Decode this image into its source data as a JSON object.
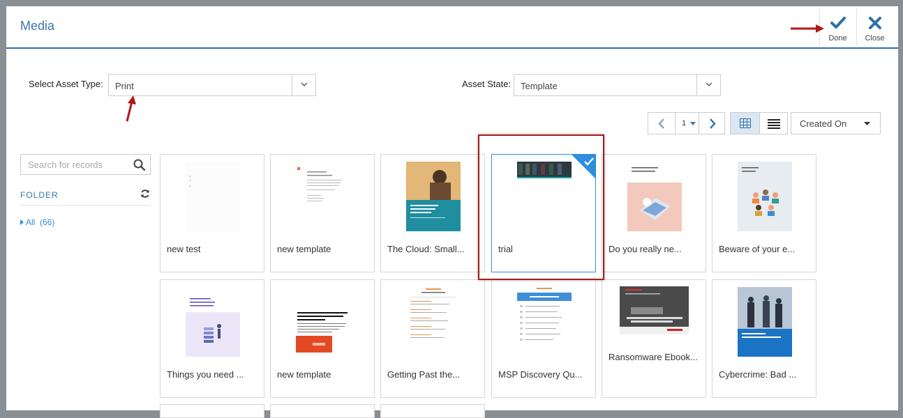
{
  "modal": {
    "title": "Media",
    "done_label": "Done",
    "close_label": "Close"
  },
  "filters": {
    "asset_type_label": "Select Asset Type:",
    "asset_type_value": "Print",
    "asset_state_label": "Asset State:",
    "asset_state_value": "Template"
  },
  "pager": {
    "current_page": "1"
  },
  "sort": {
    "value": "Created On"
  },
  "sidebar": {
    "search_placeholder": "Search for records",
    "folder_label": "FOLDER",
    "all_label": "All",
    "all_count": "(66)"
  },
  "assets": [
    {
      "name": "new test",
      "selected": false
    },
    {
      "name": "new template",
      "selected": false
    },
    {
      "name": "The Cloud: Small...",
      "selected": false
    },
    {
      "name": "trial",
      "selected": true
    },
    {
      "name": "Do you really ne...",
      "selected": false
    },
    {
      "name": "Beware of your e...",
      "selected": false
    },
    {
      "name": "Things you need ...",
      "selected": false
    },
    {
      "name": "new template",
      "selected": false
    },
    {
      "name": "Getting Past the...",
      "selected": false
    },
    {
      "name": "MSP Discovery Qu...",
      "selected": false
    },
    {
      "name": "Ransomware Ebook...",
      "selected": false
    },
    {
      "name": "Cybercrime: Bad ...",
      "selected": false
    }
  ],
  "colors": {
    "accent": "#2f6fa7",
    "selected_border": "#2e8ee0",
    "highlight_frame": "#a51c1c",
    "annotation_arrow": "#b01818"
  }
}
